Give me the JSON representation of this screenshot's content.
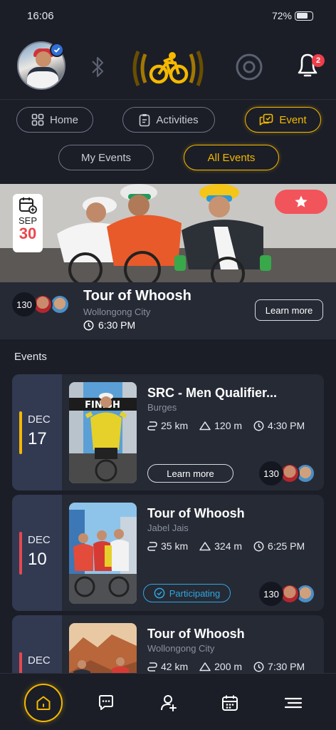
{
  "status_bar": {
    "time": "16:06",
    "battery": "72%",
    "battery_level": 0.72
  },
  "header": {
    "notification_count": "2"
  },
  "tabs": [
    {
      "label": "Home",
      "icon": "grid-icon"
    },
    {
      "label": "Activities",
      "icon": "clipboard-icon"
    },
    {
      "label": "Event",
      "icon": "event-icon",
      "active": true
    }
  ],
  "subtabs": [
    {
      "label": "My Events"
    },
    {
      "label": "All Events",
      "active": true
    }
  ],
  "featured": {
    "month": "SEP",
    "day": "30",
    "title": "Tour of Whoosh",
    "location": "Wollongong City",
    "time": "6:30 PM",
    "participants": "130",
    "button": "Learn more"
  },
  "events_heading": "Events",
  "events": [
    {
      "month": "DEC",
      "day": "17",
      "title": "SRC - Men Qualifier...",
      "location": "Burges",
      "distance": "25 km",
      "elevation": "120 m",
      "time": "4:30 PM",
      "action": "Learn more",
      "participants": "130",
      "bar_color": "#f5b800"
    },
    {
      "month": "DEC",
      "day": "10",
      "title": "Tour of Whoosh",
      "location": "Jabel Jais",
      "distance": "35 km",
      "elevation": "324 m",
      "time": "6:25 PM",
      "action": "Participating",
      "participants": "130",
      "bar_color": "#e8484f"
    },
    {
      "month": "DEC",
      "day": "",
      "title": "Tour of Whoosh",
      "location": "Wollongong City",
      "distance": "42 km",
      "elevation": "200 m",
      "time": "7:30 PM",
      "bar_color": "#e8484f"
    }
  ],
  "nav": [
    {
      "icon": "home-icon",
      "active": true
    },
    {
      "icon": "chat-icon"
    },
    {
      "icon": "add-user-icon"
    },
    {
      "icon": "calendar-icon"
    },
    {
      "icon": "menu-icon"
    }
  ],
  "colors": {
    "accent": "#f5b800",
    "background": "#1b1e27",
    "card": "#262a35",
    "participating": "#2ea7e0",
    "favorite": "#f2545b"
  }
}
